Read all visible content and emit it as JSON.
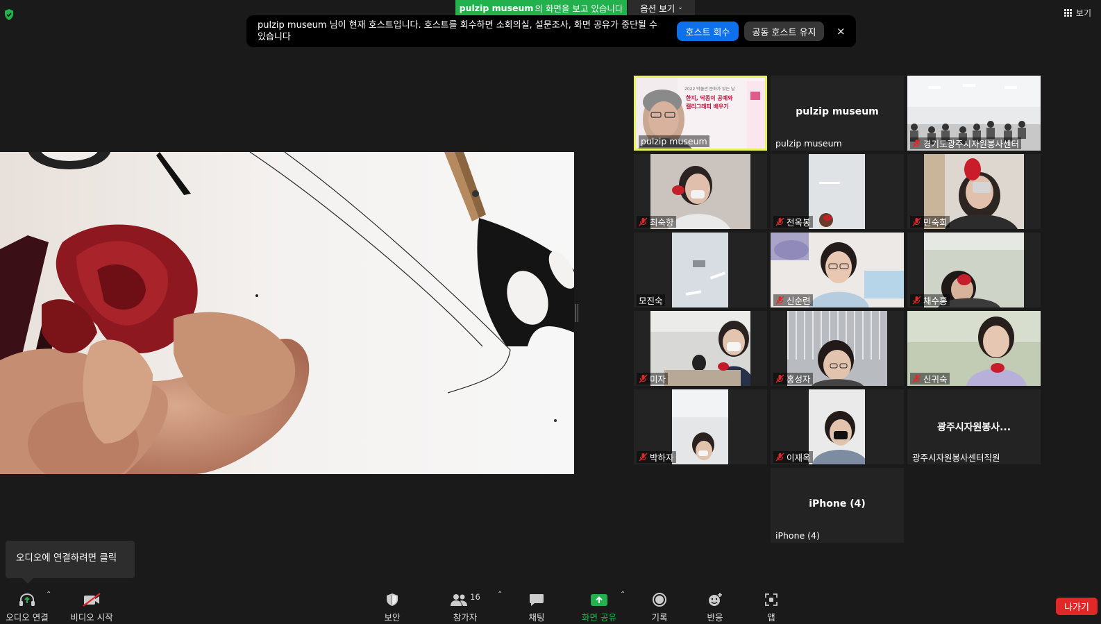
{
  "top_bar": {
    "share_name": "pulzip  museum",
    "share_suffix": "의 화면을 보고 있습니다",
    "view_options": "옵션 보기",
    "view_label": "보기"
  },
  "notice": {
    "text": "pulzip museum 님이 현재 호스트입니다. 호스트를 회수하면 소회의실, 설문조사, 화면 공유가 중단될 수 있습니다",
    "reclaim_label": "호스트 회수",
    "keep_label": "공동 호스트 유지",
    "close_icon": "×"
  },
  "participants": [
    {
      "name": "pulzip museum",
      "muted": false,
      "active": true,
      "has_video": true
    },
    {
      "name": "pulzip museum",
      "muted": false,
      "active": false,
      "has_video": false,
      "center_name": "pulzip museum"
    },
    {
      "name": "경기도광주시자원봉사센터",
      "muted": true,
      "active": false,
      "has_video": true
    },
    {
      "name": "최숙향",
      "muted": true,
      "has_video": true
    },
    {
      "name": "전옥봉",
      "muted": true,
      "has_video": true
    },
    {
      "name": "민숙희",
      "muted": true,
      "has_video": true
    },
    {
      "name": "모진숙",
      "muted": false,
      "has_video": true
    },
    {
      "name": "신순련",
      "muted": true,
      "has_video": true
    },
    {
      "name": "채수홍",
      "muted": true,
      "has_video": true
    },
    {
      "name": "미자",
      "muted": true,
      "has_video": true
    },
    {
      "name": "홍성자",
      "muted": true,
      "has_video": true
    },
    {
      "name": "신귀숙",
      "muted": true,
      "has_video": true
    },
    {
      "name": "박하자",
      "muted": true,
      "has_video": true
    },
    {
      "name": "이재옥",
      "muted": true,
      "has_video": true
    },
    {
      "name": "광주시자원봉사센터직원",
      "muted": false,
      "has_video": false,
      "center_name": "광주시자원봉사..."
    },
    {
      "name": "iPhone (4)",
      "muted": false,
      "has_video": false,
      "center_name": "iPhone (4)"
    }
  ],
  "poster_text": {
    "line1": "2022 박물관 문화가 있는 날",
    "line2": "한지, 닥종이 공예와",
    "line3": "캘리그래피 배우기"
  },
  "tooltip": "오디오에 연결하려면 클릭",
  "toolbar": {
    "audio": "오디오 연결",
    "video": "비디오 시작",
    "security": "보안",
    "participants": "참가자",
    "participant_count": "16",
    "chat": "채팅",
    "share": "화면 공유",
    "record": "기록",
    "reactions": "반응",
    "apps": "앱",
    "leave": "나가기"
  },
  "colors": {
    "share_green": "#22b14c",
    "blue_button": "#0e71eb",
    "leave_red": "#e02828",
    "active_border": "#e8f25a"
  }
}
